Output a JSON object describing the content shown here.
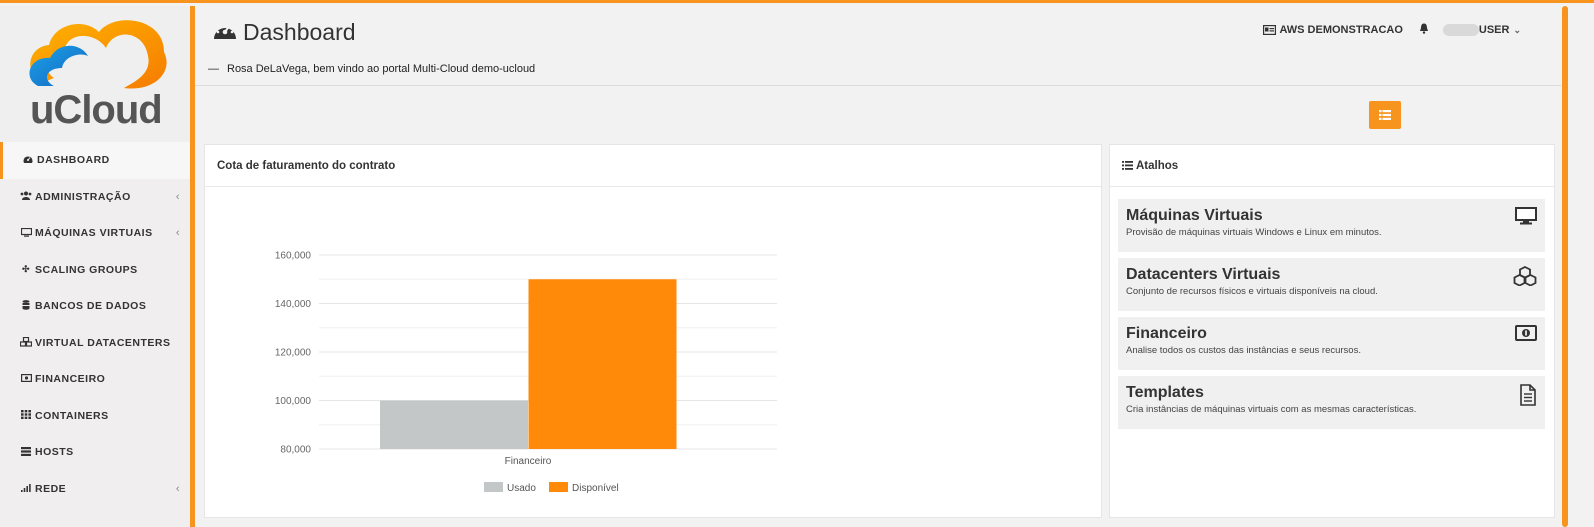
{
  "brand": {
    "logo_text": "uCloud",
    "accent_color": "#f7941d"
  },
  "sidebar": {
    "items": [
      {
        "label": "DASHBOARD",
        "icon": "dashboard-icon",
        "active": true
      },
      {
        "label": "ADMINISTRAÇÃO",
        "icon": "users-icon",
        "has_submenu": true
      },
      {
        "label": "MÁQUINAS VIRTUAIS",
        "icon": "monitor-icon",
        "has_submenu": true
      },
      {
        "label": "SCALING GROUPS",
        "icon": "arrows-icon"
      },
      {
        "label": "BANCOS DE DADOS",
        "icon": "database-icon"
      },
      {
        "label": "VIRTUAL DATACENTERS",
        "icon": "cubes-icon"
      },
      {
        "label": "FINANCEIRO",
        "icon": "money-icon"
      },
      {
        "label": "CONTAINERS",
        "icon": "grid-icon"
      },
      {
        "label": "HOSTS",
        "icon": "server-icon"
      },
      {
        "label": "REDE",
        "icon": "signal-icon",
        "has_submenu": true
      }
    ]
  },
  "header": {
    "title": "Dashboard",
    "welcome": "Rosa DeLaVega, bem vindo ao portal Multi-Cloud demo-ucloud",
    "account": "AWS DEMONSTRACAO",
    "user": "USER"
  },
  "chart_panel": {
    "title": "Cota de faturamento do contrato"
  },
  "shortcuts_panel": {
    "title": "Atalhos",
    "items": [
      {
        "title": "Máquinas Virtuais",
        "desc": "Provisão de máquinas virtuais Windows e Linux em minutos.",
        "icon": "monitor-icon"
      },
      {
        "title": "Datacenters Virtuais",
        "desc": "Conjunto de recursos físicos e virtuais disponíveis na cloud.",
        "icon": "cubes-icon"
      },
      {
        "title": "Financeiro",
        "desc": "Analise todos os custos das instâncias e seus recursos.",
        "icon": "money-icon"
      },
      {
        "title": "Templates",
        "desc": "Cria instâncias de máquinas virtuais com as mesmas características.",
        "icon": "document-icon"
      }
    ]
  },
  "chart_data": {
    "type": "bar",
    "categories": [
      "Financeiro"
    ],
    "series": [
      {
        "name": "Usado",
        "values": [
          100000
        ],
        "color": "#c4c7c7"
      },
      {
        "name": "Disponível",
        "values": [
          150000
        ],
        "color": "#ff8a0a"
      }
    ],
    "ylim": [
      80000,
      160000
    ],
    "yticks": [
      80000,
      100000,
      120000,
      140000,
      160000
    ],
    "ytick_labels": [
      "80,000",
      "100,000",
      "120,000",
      "140,000",
      "160,000"
    ],
    "grid": true,
    "legend": "bottom"
  }
}
